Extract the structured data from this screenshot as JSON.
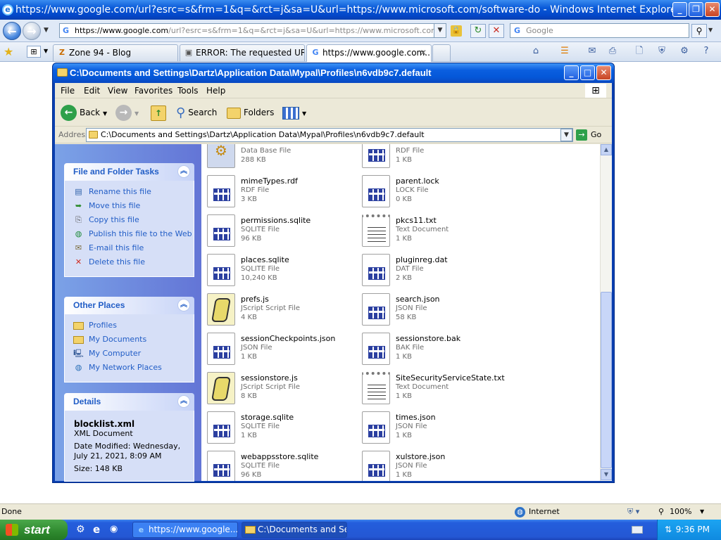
{
  "ie": {
    "title": "https://www.google.com/url?esrc=s&frm=1&q=&rct=j&sa=U&url=https://www.microsoft.com/software-do - Windows Internet Explorer",
    "address_prefix": "https://",
    "address_host": "www.google.com",
    "address_rest": "/url?esrc=s&frm=1&q=&rct=j&sa=U&url=https://www.microsoft.com/software-",
    "search_placeholder": "Google",
    "tabs": [
      {
        "label": "Zone 94 - Blog"
      },
      {
        "label": "ERROR: The requested URL ..."
      },
      {
        "label": "https://www.google.com..."
      }
    ]
  },
  "explorer": {
    "title": "C:\\Documents and Settings\\Dartz\\Application Data\\Mypal\\Profiles\\n6vdb9c7.default",
    "menu": [
      "File",
      "Edit",
      "View",
      "Favorites",
      "Tools",
      "Help"
    ],
    "toolbar": {
      "back": "Back",
      "search": "Search",
      "folders": "Folders"
    },
    "address_label": "Address",
    "address_value": "C:\\Documents and Settings\\Dartz\\Application Data\\Mypal\\Profiles\\n6vdb9c7.default",
    "go": "Go",
    "file_tasks": {
      "title": "File and Folder Tasks",
      "items": [
        "Rename this file",
        "Move this file",
        "Copy this file",
        "Publish this file to the Web",
        "E-mail this file",
        "Delete this file"
      ]
    },
    "other_places": {
      "title": "Other Places",
      "items": [
        "Profiles",
        "My Documents",
        "My Computer",
        "My Network Places"
      ]
    },
    "details": {
      "title": "Details",
      "name": "blocklist.xml",
      "type": "XML Document",
      "modified": "Date Modified: Wednesday, July 21, 2021, 8:09 AM",
      "size": "Size: 148 KB"
    },
    "files": [
      {
        "name": "",
        "type": "Data Base File",
        "size": "288 KB",
        "icon": "gear"
      },
      {
        "name": "",
        "type": "RDF File",
        "size": "1 KB",
        "icon": "grid"
      },
      {
        "name": "mimeTypes.rdf",
        "type": "RDF File",
        "size": "3 KB",
        "icon": "grid"
      },
      {
        "name": "parent.lock",
        "type": "LOCK File",
        "size": "0 KB",
        "icon": "grid"
      },
      {
        "name": "permissions.sqlite",
        "type": "SQLITE File",
        "size": "96 KB",
        "icon": "grid"
      },
      {
        "name": "pkcs11.txt",
        "type": "Text Document",
        "size": "1 KB",
        "icon": "txt"
      },
      {
        "name": "places.sqlite",
        "type": "SQLITE File",
        "size": "10,240 KB",
        "icon": "grid"
      },
      {
        "name": "pluginreg.dat",
        "type": "DAT File",
        "size": "2 KB",
        "icon": "grid"
      },
      {
        "name": "prefs.js",
        "type": "JScript Script File",
        "size": "4 KB",
        "icon": "js"
      },
      {
        "name": "search.json",
        "type": "JSON File",
        "size": "58 KB",
        "icon": "grid"
      },
      {
        "name": "sessionCheckpoints.json",
        "type": "JSON File",
        "size": "1 KB",
        "icon": "grid"
      },
      {
        "name": "sessionstore.bak",
        "type": "BAK File",
        "size": "1 KB",
        "icon": "grid"
      },
      {
        "name": "sessionstore.js",
        "type": "JScript Script File",
        "size": "8 KB",
        "icon": "js"
      },
      {
        "name": "SiteSecurityServiceState.txt",
        "type": "Text Document",
        "size": "1 KB",
        "icon": "txt"
      },
      {
        "name": "storage.sqlite",
        "type": "SQLITE File",
        "size": "1 KB",
        "icon": "grid"
      },
      {
        "name": "times.json",
        "type": "JSON File",
        "size": "1 KB",
        "icon": "grid"
      },
      {
        "name": "webappsstore.sqlite",
        "type": "SQLITE File",
        "size": "96 KB",
        "icon": "grid"
      },
      {
        "name": "xulstore.json",
        "type": "JSON File",
        "size": "1 KB",
        "icon": "grid"
      }
    ]
  },
  "status": {
    "left": "Done",
    "zone": "Internet",
    "zoom": "100%"
  },
  "taskbar": {
    "start": "start",
    "tasks": [
      "https://www.google....",
      "C:\\Documents and Se..."
    ],
    "clock": "9:36 PM"
  }
}
